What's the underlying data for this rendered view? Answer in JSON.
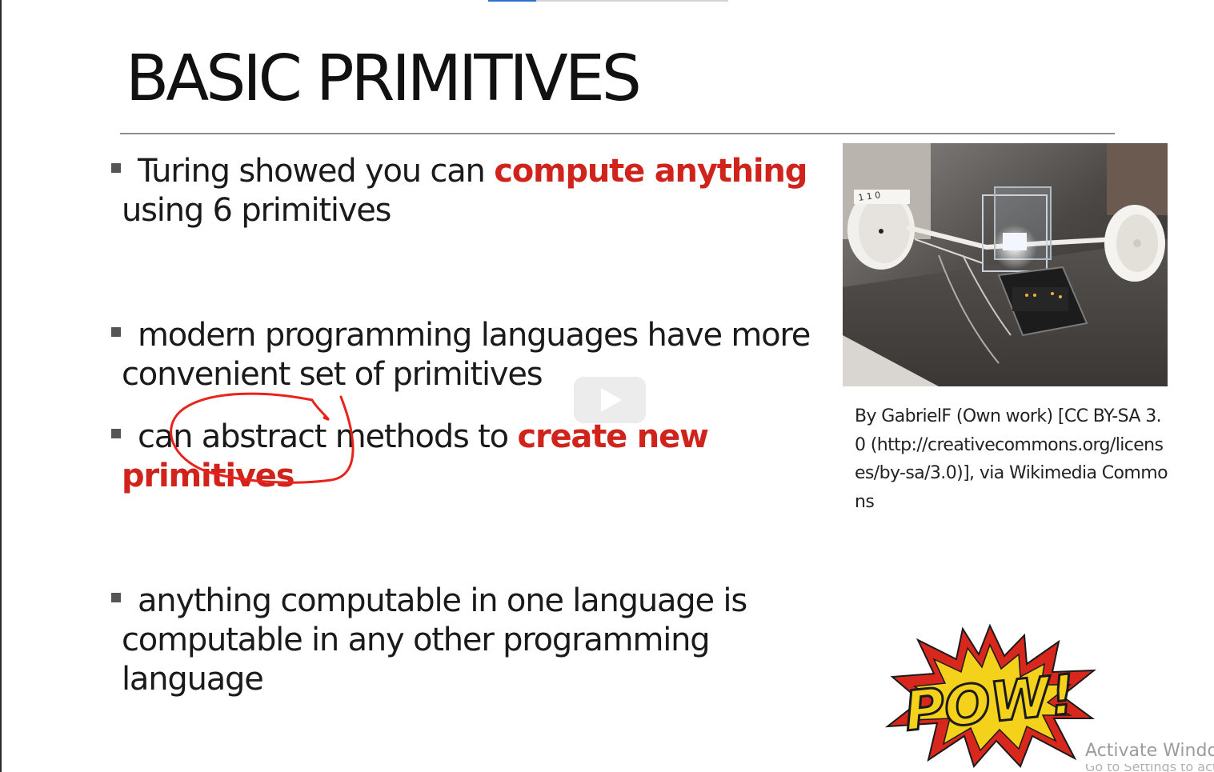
{
  "slide": {
    "title": "BASIC PRIMITIVES",
    "bullets": [
      {
        "text_before": "Turing showed you can ",
        "highlight": "compute anything",
        "text_after": " using 6 primitives"
      },
      {
        "text_before": "modern programming languages have more convenient set of primitives",
        "highlight": "",
        "text_after": ""
      },
      {
        "text_before": "can abstract methods to ",
        "highlight": "create new primitives",
        "text_after": ""
      },
      {
        "text_before": "anything computable in one language is computable in any other programming language",
        "highlight": "",
        "text_after": ""
      }
    ],
    "image_caption": "By GabrielF (Own work) [CC BY-SA 3.0 (http://creativecommons.org/licenses/by-sa/3.0)], via Wikimedia Commons",
    "photo_tape_digits": "1 1 0",
    "pow_text": "POW!"
  },
  "overlay": {
    "play_button_icon": "play-icon",
    "annotation": "red-circle-around-abstract",
    "watermark": "Activate Windo",
    "watermark_sub": "Go to Settings to activate Windows."
  },
  "colors": {
    "highlight": "#d0231c",
    "text": "#1a1a1a",
    "annotation": "#e8231c",
    "pow_fill": "#f4d21c",
    "pow_burst": "#d8281e"
  }
}
